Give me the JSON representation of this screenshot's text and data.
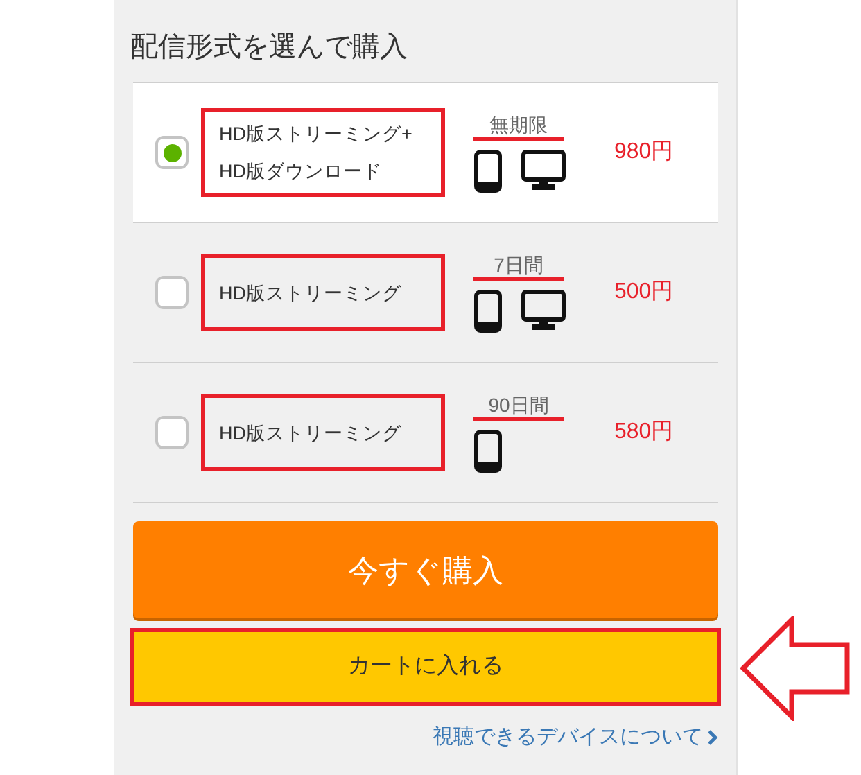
{
  "title": "配信形式を選んで購入",
  "options": [
    {
      "lines": [
        "HD版ストリーミング+",
        "HD版ダウンロード"
      ],
      "period": "無期限",
      "devices": [
        {
          "kind": "phone"
        },
        {
          "kind": "monitor"
        }
      ],
      "price": "980円",
      "selected": true
    },
    {
      "lines": [
        "HD版ストリーミング"
      ],
      "period": "7日間",
      "devices": [
        {
          "kind": "phone"
        },
        {
          "kind": "monitor"
        }
      ],
      "price": "500円",
      "selected": false
    },
    {
      "lines": [
        "HD版ストリーミング"
      ],
      "period": "90日間",
      "devices": [
        {
          "kind": "phone"
        }
      ],
      "price": "580円",
      "selected": false
    }
  ],
  "buy_button": "今すぐ購入",
  "cart_button": "カートに入れる",
  "devices_link": "視聴できるデバイスについて"
}
